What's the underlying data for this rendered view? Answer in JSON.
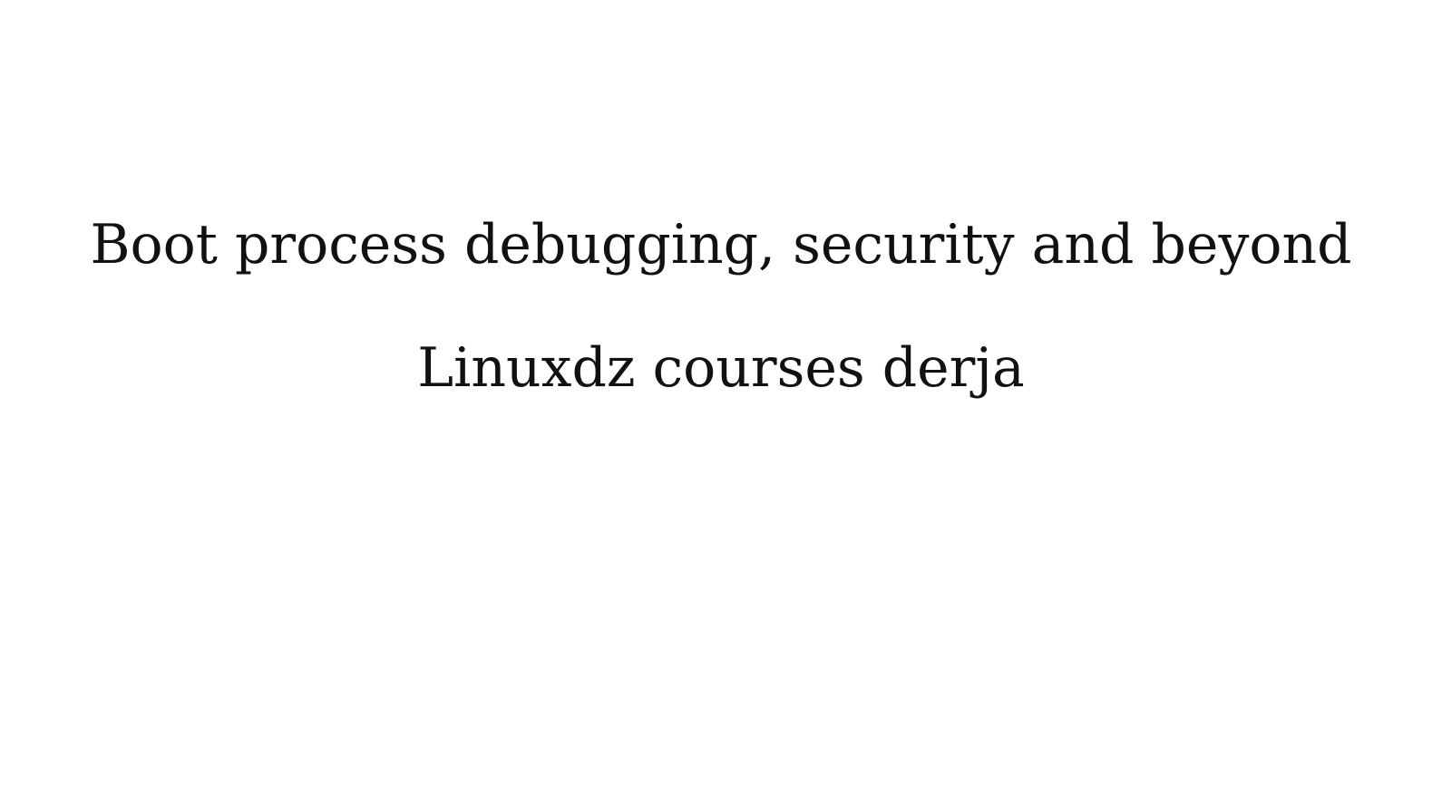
{
  "slide": {
    "title": "Boot process debugging, security and beyond",
    "subtitle": "Linuxdz courses derja"
  }
}
